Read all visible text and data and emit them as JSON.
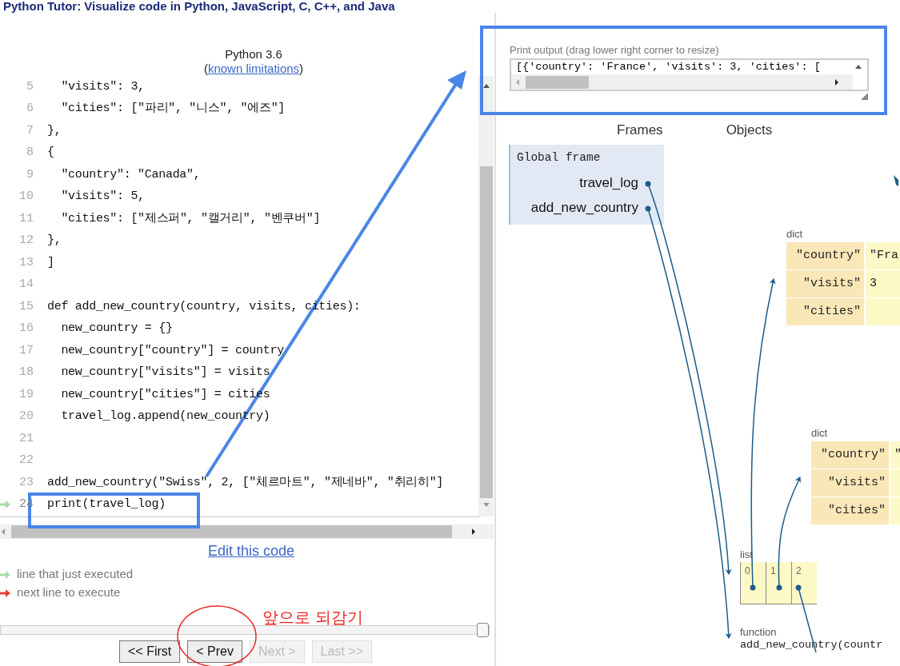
{
  "page_title": "Python Tutor: Visualize code in Python, JavaScript, C, C++, and Java",
  "editor": {
    "language": "Python 3.6",
    "limitations_open": "(",
    "limitations_link": "known limitations",
    "limitations_close": ")",
    "lines": [
      {
        "number": "5",
        "text": "  \"visits\": 3,",
        "just_executed": false
      },
      {
        "number": "6",
        "text": "  \"cities\": [\"파리\", \"니스\", \"에즈\"]",
        "just_executed": false
      },
      {
        "number": "7",
        "text": "},",
        "just_executed": false
      },
      {
        "number": "8",
        "text": "{",
        "just_executed": false
      },
      {
        "number": "9",
        "text": "  \"country\": \"Canada\",",
        "just_executed": false
      },
      {
        "number": "10",
        "text": "  \"visits\": 5,",
        "just_executed": false
      },
      {
        "number": "11",
        "text": "  \"cities\": [\"제스퍼\", \"캘거리\", \"벤쿠버\"]",
        "just_executed": false
      },
      {
        "number": "12",
        "text": "},",
        "just_executed": false
      },
      {
        "number": "13",
        "text": "]",
        "just_executed": false
      },
      {
        "number": "14",
        "just_executed": false
      },
      {
        "number": "15",
        "text": "def add_new_country(country, visits, cities):",
        "just_executed": false
      },
      {
        "number": "16",
        "text": "  new_country = {}",
        "just_executed": false
      },
      {
        "number": "17",
        "text": "  new_country[\"country\"] = country",
        "just_executed": false
      },
      {
        "number": "18",
        "text": "  new_country[\"visits\"] = visits",
        "just_executed": false
      },
      {
        "number": "19",
        "text": "  new_country[\"cities\"] = cities",
        "just_executed": false
      },
      {
        "number": "20",
        "text": "  travel_log.append(new_country)",
        "just_executed": false
      },
      {
        "number": "21",
        "just_executed": false
      },
      {
        "number": "22",
        "just_executed": false
      },
      {
        "number": "23",
        "text": "add_new_country(\"Swiss\", 2, [\"체르마트\", \"제네바\", \"취리히\"]",
        "just_executed": false
      },
      {
        "number": "24",
        "text": "print(travel_log)",
        "just_executed": true
      }
    ],
    "edit_link": "Edit this code",
    "legend": [
      {
        "kind": "executed",
        "label": "line that just executed"
      },
      {
        "kind": "next",
        "label": "next line to execute"
      }
    ],
    "step_slider": {
      "level": 1
    },
    "buttons": [
      {
        "label": "<< First",
        "disabled": false
      },
      {
        "label": "< Prev",
        "disabled": false
      },
      {
        "label": "Next >",
        "disabled": true
      },
      {
        "label": "Last >>",
        "disabled": true
      }
    ]
  },
  "print_output": {
    "label": "Print output (drag lower right corner to resize)",
    "text": "[{'country': 'France', 'visits': 3, 'cities': ["
  },
  "visualizer": {
    "frames_heading": "Frames",
    "objects_heading": "Objects",
    "global_frame": {
      "title": "Global frame",
      "variables": [
        "travel_log",
        "add_new_country"
      ]
    },
    "dicts": [
      {
        "type": "dict",
        "rows": [
          {
            "key": "\"country\"",
            "value": "\"Fra"
          },
          {
            "key": "\"visits\"",
            "value": "3"
          },
          {
            "key": "\"cities\""
          }
        ]
      },
      {
        "type": "dict",
        "rows": [
          {
            "key": "\"country\"",
            "value": "\""
          },
          {
            "key": "\"visits\""
          },
          {
            "key": "\"cities\""
          }
        ]
      }
    ],
    "list": {
      "type": "list",
      "indices": [
        "0",
        "1",
        "2"
      ]
    },
    "function": {
      "type": "function",
      "text": "add_new_country(countr"
    }
  },
  "annotation": {
    "label": "앞으로 되감기"
  }
}
